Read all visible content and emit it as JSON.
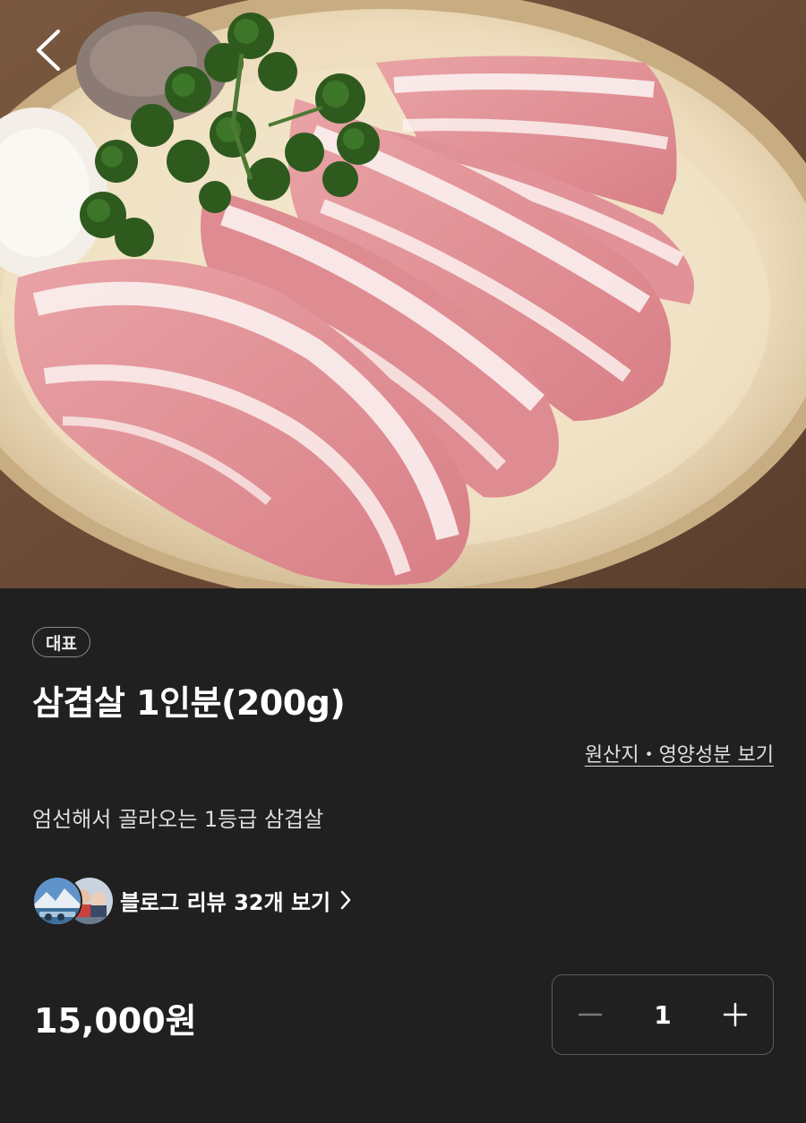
{
  "header": {
    "back_icon": "chevron-left-icon"
  },
  "product": {
    "image_subject": "raw pork belly slices with parsley on a round plate",
    "badge": "대표",
    "title": "삼겹살 1인분(200g)",
    "origin_link": "원산지・영양성분 보기",
    "description": "엄선해서 골라오는 1등급 삼겹살",
    "price": "15,000원"
  },
  "reviews": {
    "label": "블로그 리뷰 32개 보기",
    "chevron_icon": "chevron-right-icon",
    "avatar_icons": [
      "avatar-mountain-icon",
      "avatar-people-icon"
    ]
  },
  "quantity": {
    "value": "1",
    "minus_icon": "minus-icon",
    "plus_icon": "plus-icon"
  },
  "colors": {
    "background": "#202020",
    "text_primary": "#ffffff",
    "text_secondary": "#dcdcdc",
    "border": "#5c5c5c",
    "minus_disabled": "#7a7a7a"
  }
}
